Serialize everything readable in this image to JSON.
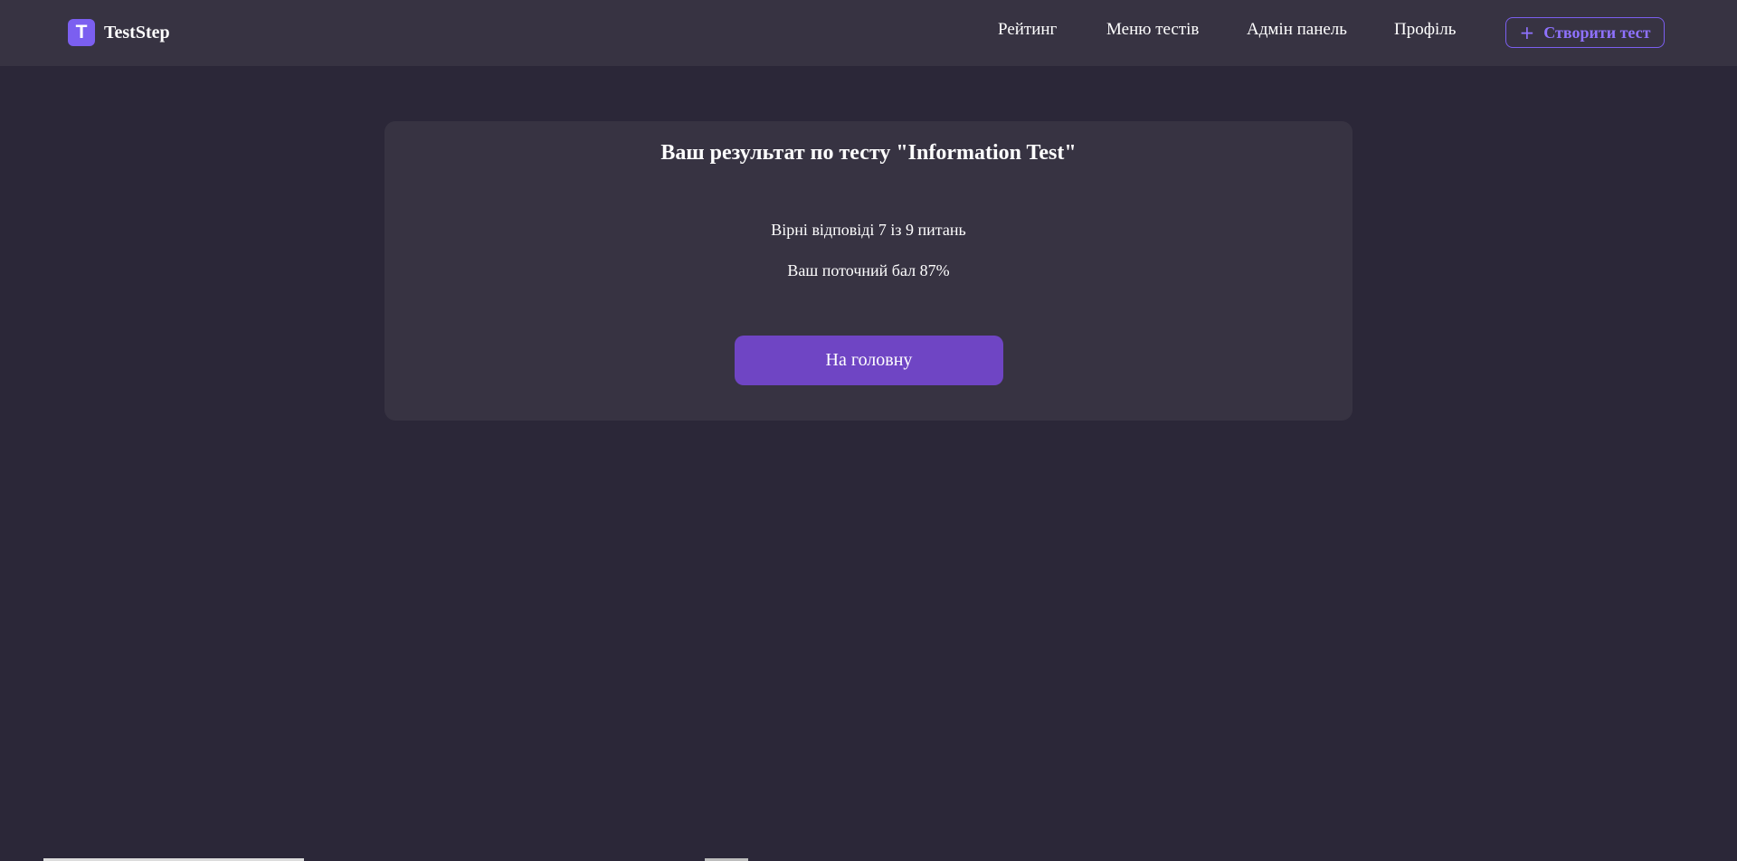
{
  "brand": {
    "logo_letter": "T",
    "name": "TestStep"
  },
  "nav": {
    "rating": "Рейтинг",
    "tests_menu": "Меню тестів",
    "admin_panel": "Адмін панель",
    "profile": "Профіль",
    "create_test": "Створити тест",
    "create_icon": "plus-icon"
  },
  "result": {
    "title": "Ваш результат по тесту \"Information Test\"",
    "correct_answers": "Вірні відповіді 7 із 9 питань",
    "current_score": "Ваш поточний бал 87%",
    "home_button": "На головну"
  },
  "colors": {
    "background": "#2b2738",
    "surface": "#373342",
    "accent": "#7b5ff0",
    "button": "#6f45c4"
  }
}
